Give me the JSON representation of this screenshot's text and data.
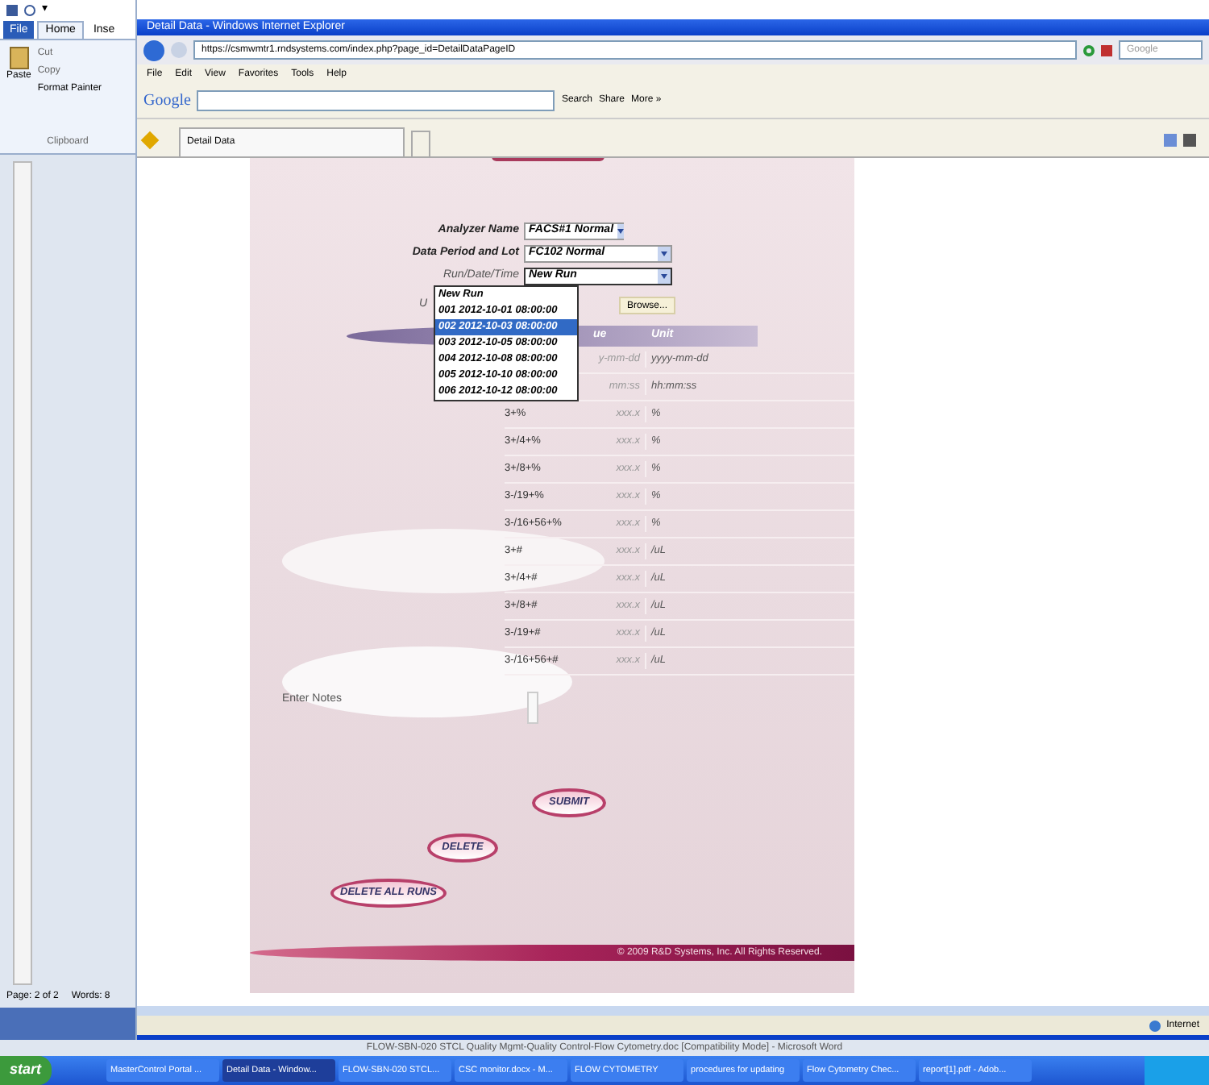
{
  "word": {
    "quick_access": "▾",
    "tabs": [
      {
        "label": "File",
        "selected": false
      },
      {
        "label": "Home",
        "selected": true
      },
      {
        "label": "Inse",
        "selected": false
      }
    ],
    "clipboard": {
      "paste": "Paste",
      "cut": "Cut",
      "copy": "Copy",
      "format_painter": "Format Painter",
      "group": "Clipboard"
    },
    "status": [
      "Page: 2 of 2",
      "Words: 8"
    ],
    "title": "FLOW-SBN-020 STCL Quality Mgmt-Quality Control-Flow Cytometry.doc [Compatibility Mode] - Microsoft Word"
  },
  "browser": {
    "title": "Detail Data - Windows Internet Explorer",
    "address": "https://csmwmtr1.rndsystems.com/index.php?page_id=DetailDataPageID",
    "search_placeholder": "Google",
    "menu": [
      "File",
      "Edit",
      "View",
      "Favorites",
      "Tools",
      "Help"
    ],
    "google_toolbar": {
      "logo": "Google",
      "search": "Search",
      "share": "Share",
      "more": "More »"
    },
    "tab": "Detail Data",
    "status": "Internet"
  },
  "form": {
    "fields": [
      {
        "label": "Analyzer Name",
        "value": "FACS#1 Normal",
        "expanded": false
      },
      {
        "label": "Data Period and Lot",
        "value": "FC102 Normal",
        "expanded": false
      },
      {
        "label": "Run/Date/Time",
        "value": "New Run",
        "expanded": true
      }
    ],
    "options": [
      {
        "label": "New Run",
        "selected": false
      },
      {
        "label": "001 2012-10-01 08:00:00",
        "selected": false
      },
      {
        "label": "002 2012-10-03 08:00:00",
        "selected": true
      },
      {
        "label": "003 2012-10-05 08:00:00",
        "selected": false
      },
      {
        "label": "004 2012-10-08 08:00:00",
        "selected": false
      },
      {
        "label": "005 2012-10-10 08:00:00",
        "selected": false
      },
      {
        "label": "006 2012-10-12 08:00:00",
        "selected": false
      }
    ],
    "upload_label": "U",
    "browse": "Browse...",
    "table": {
      "columns": [
        "",
        "ue",
        "Unit"
      ],
      "rows": [
        [
          "",
          "y-mm-dd",
          "yyyy-mm-dd"
        ],
        [
          "",
          "mm:ss",
          "hh:mm:ss"
        ],
        [
          "3+%",
          "xxx.x",
          "%"
        ],
        [
          "3+/4+%",
          "xxx.x",
          "%"
        ],
        [
          "3+/8+%",
          "xxx.x",
          "%"
        ],
        [
          "3-/19+%",
          "xxx.x",
          "%"
        ],
        [
          "3-/16+56+%",
          "xxx.x",
          "%"
        ],
        [
          "3+#",
          "xxx.x",
          "/uL"
        ],
        [
          "3+/4+#",
          "xxx.x",
          "/uL"
        ],
        [
          "3+/8+#",
          "xxx.x",
          "/uL"
        ],
        [
          "3-/19+#",
          "xxx.x",
          "/uL"
        ],
        [
          "3-/16+56+#",
          "xxx.x",
          "/uL"
        ]
      ]
    },
    "notes_label": "Enter Notes",
    "buttons": [
      "SUBMIT",
      "DELETE",
      "DELETE ALL RUNS"
    ],
    "footer": "© 2009 R&D Systems, Inc. All Rights Reserved."
  },
  "taskbar": {
    "start": "start",
    "items": [
      {
        "label": "MasterControl Portal ...",
        "selected": false
      },
      {
        "label": "Detail Data - Window...",
        "selected": true
      },
      {
        "label": "FLOW-SBN-020 STCL...",
        "selected": false
      },
      {
        "label": "CSC monitor.docx - M...",
        "selected": false
      },
      {
        "label": "FLOW CYTOMETRY",
        "selected": false
      },
      {
        "label": "procedures for updating",
        "selected": false
      },
      {
        "label": "Flow Cytometry Chec...",
        "selected": false
      },
      {
        "label": "report[1].pdf - Adob...",
        "selected": false
      }
    ]
  }
}
